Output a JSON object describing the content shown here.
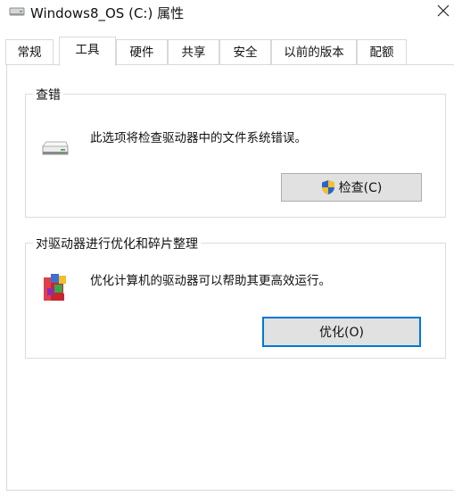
{
  "window": {
    "title": "Windows8_OS (C:) 属性",
    "icons": {
      "title": "drive-icon",
      "close": "close-icon"
    }
  },
  "tabs": [
    {
      "label": "常规",
      "active": false
    },
    {
      "label": "工具",
      "active": true
    },
    {
      "label": "硬件",
      "active": false
    },
    {
      "label": "共享",
      "active": false
    },
    {
      "label": "安全",
      "active": false
    },
    {
      "label": "以前的版本",
      "active": false
    },
    {
      "label": "配额",
      "active": false
    }
  ],
  "error_check": {
    "title": "查错",
    "description": "此选项将检查驱动器中的文件系统错误。",
    "button_label": "检查(C)",
    "icons": {
      "drive": "hard-drive-icon",
      "button": "shield-icon"
    }
  },
  "optimize": {
    "title": "对驱动器进行优化和碎片整理",
    "description": "优化计算机的驱动器可以帮助其更高效运行。",
    "button_label": "优化(O)",
    "icons": {
      "section": "defrag-icon"
    }
  },
  "colors": {
    "accent": "#0078d7",
    "button_face": "#e1e1e1",
    "border": "#d9d9d9"
  }
}
